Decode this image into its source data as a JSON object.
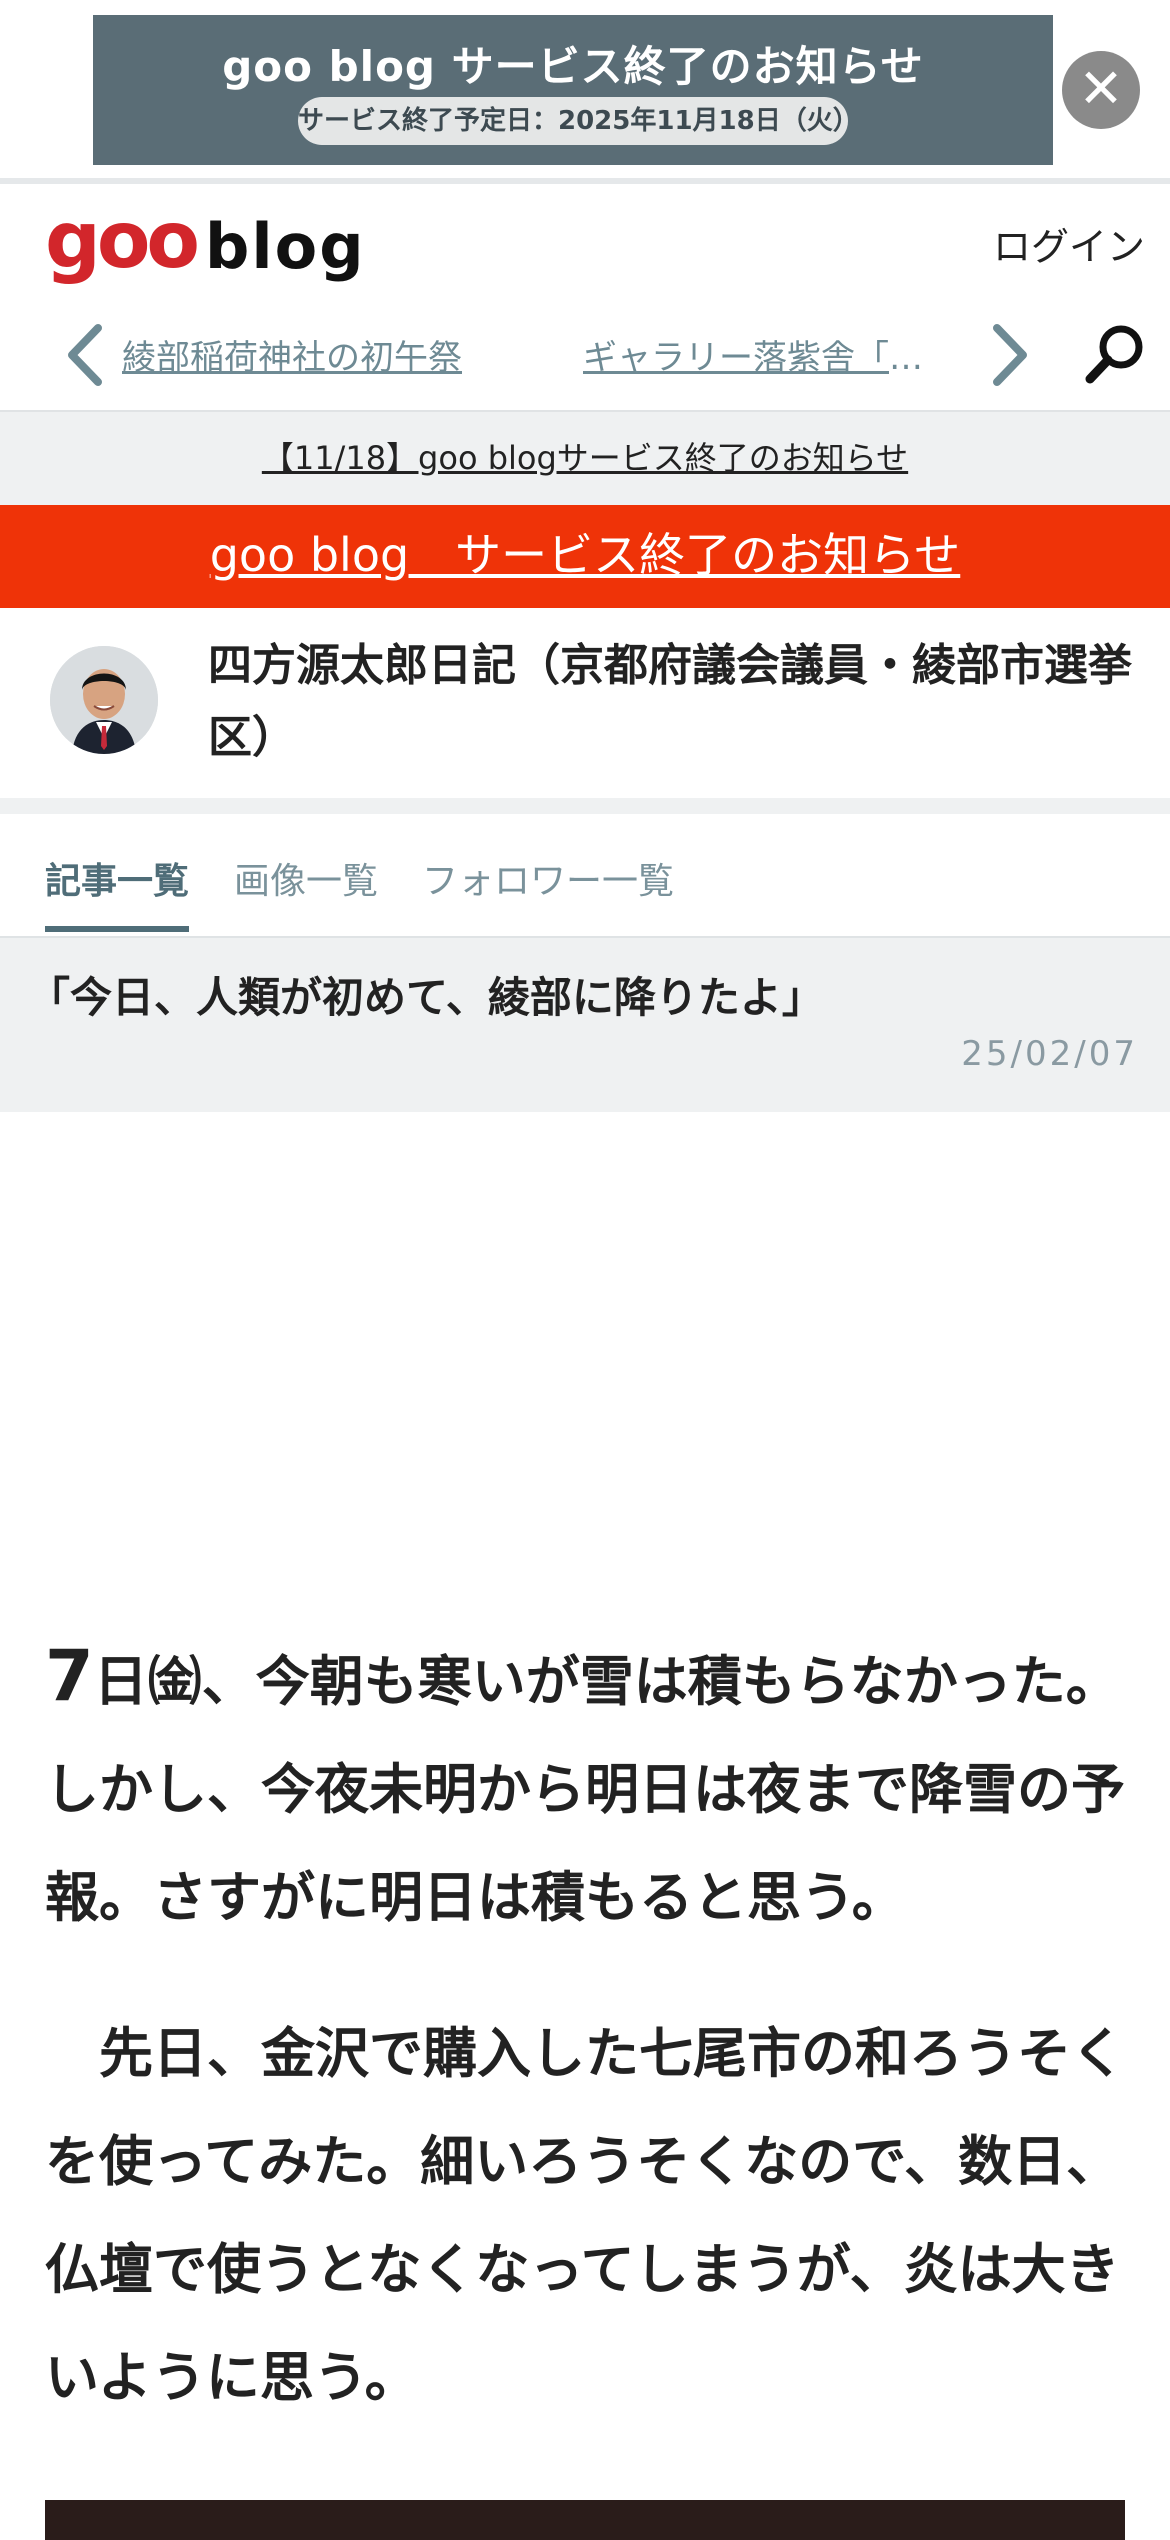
{
  "banner": {
    "title": "goo blog サービス終了のお知らせ",
    "date_pill": "サービス終了予定日：2025年11月18日（火）",
    "close_symbol": "✕"
  },
  "header": {
    "logo_goo": "goo",
    "logo_blog": "blog",
    "login_label": "ログイン",
    "prev_article": "綾部稲荷神社の初午祭",
    "next_article": "ギャラリー落紫舎「名…"
  },
  "notices": {
    "gray": "【11/18】goo blogサービス終了のお知らせ",
    "red": "goo blog　サービス終了のお知らせ"
  },
  "blog": {
    "title": "四方源太郎日記（京都府議会議員・綾部市選挙区）"
  },
  "tabs": [
    {
      "label": "記事一覧",
      "active": true
    },
    {
      "label": "画像一覧",
      "active": false
    },
    {
      "label": "フォロワー一覧",
      "active": false
    }
  ],
  "article": {
    "title": "「今日、人類が初めて、綾部に降りたよ」",
    "date": "25/02/07",
    "p1_num": "7",
    "p1_rest": "日㈮、今朝も寒いが雪は積もらなかった。しかし、今夜未明から明日は夜まで降雪の予報。さすがに明日は積もると思う。",
    "p2": "先日、金沢で購入した七尾市の和ろうそくを使ってみた。細いろうそくなので、数日、仏壇で使うとなくなってしまうが、炎は大きいように思う。"
  },
  "colors": {
    "brand_red": "#d2262b",
    "notice_red": "#ef3308",
    "banner_bg": "#5a6d76",
    "tab_active": "#4f6d78"
  }
}
